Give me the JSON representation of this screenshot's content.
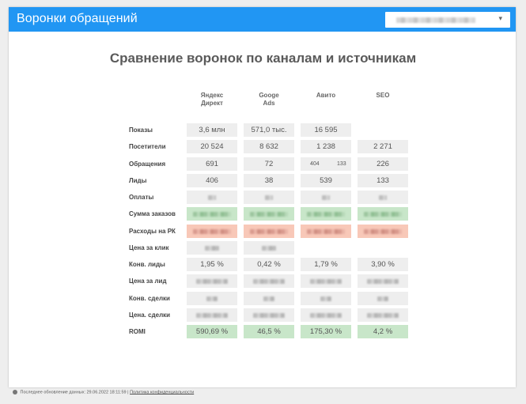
{
  "header": {
    "title": "Воронки обращений"
  },
  "report": {
    "title": "Сравнение воронок по каналам и источникам"
  },
  "columns": [
    "Яндекс\nДирект",
    "Googe\nAds",
    "Авито",
    "SEO"
  ],
  "rows": [
    {
      "label": "Показы",
      "cells": [
        {
          "v": "3,6 млн"
        },
        {
          "v": "571,0 тыс."
        },
        {
          "v": "16 595"
        },
        null
      ]
    },
    {
      "label": "Посетители",
      "cells": [
        {
          "v": "20 524"
        },
        {
          "v": "8 632"
        },
        {
          "v": "1 238"
        },
        {
          "v": "2 271"
        }
      ]
    },
    {
      "label": "Обращения",
      "cells": [
        {
          "v": "691"
        },
        {
          "v": "72"
        },
        {
          "split": [
            "404",
            "133"
          ]
        },
        {
          "v": "226"
        }
      ]
    },
    {
      "label": "Лиды",
      "cells": [
        {
          "v": "406"
        },
        {
          "v": "38"
        },
        {
          "v": "539"
        },
        {
          "v": "133"
        }
      ]
    },
    {
      "label": "Оплаты",
      "cells": [
        {
          "blur": 1
        },
        {
          "blur": 1
        },
        {
          "blur": 1
        },
        {
          "blur": 1
        }
      ]
    },
    {
      "label": "Сумма заказов",
      "tone": "green",
      "cells": [
        {
          "blur": 1
        },
        {
          "blur": 1
        },
        {
          "blur": 1
        },
        {
          "blur": 1
        }
      ]
    },
    {
      "label": "Расходы на РК",
      "tone": "red",
      "cells": [
        {
          "blur": 1
        },
        {
          "blur": 1
        },
        {
          "blur": 1
        },
        {
          "blur": 1
        }
      ]
    },
    {
      "label": "Цена за клик",
      "cells": [
        {
          "blur": 1
        },
        {
          "blur": 1
        },
        null,
        null
      ]
    },
    {
      "label": "Конв. лиды",
      "cells": [
        {
          "v": "1,95 %"
        },
        {
          "v": "0,42 %"
        },
        {
          "v": "1,79 %"
        },
        {
          "v": "3,90 %"
        }
      ]
    },
    {
      "label": "Цена за лид",
      "cells": [
        {
          "blur": 1
        },
        {
          "blur": 1
        },
        {
          "blur": 1
        },
        {
          "blur": 1
        }
      ]
    },
    {
      "label": "Конв. сделки",
      "cells": [
        {
          "blur": 1
        },
        {
          "blur": 1
        },
        {
          "blur": 1
        },
        {
          "blur": 1
        }
      ]
    },
    {
      "label": "Цена. сделки",
      "cells": [
        {
          "blur": 1
        },
        {
          "blur": 1
        },
        {
          "blur": 1
        },
        {
          "blur": 1
        }
      ]
    },
    {
      "label": "ROMI",
      "tone": "green",
      "cells": [
        {
          "v": "590,69 %"
        },
        {
          "v": "46,5 %"
        },
        {
          "v": "175,30 %"
        },
        {
          "v": "4,2 %"
        }
      ]
    }
  ],
  "footer": {
    "updated": "Последнее обновление данных: 29.06.2022 18:11:59",
    "separator": "|",
    "privacy": "Политика конфиденциальности"
  },
  "colors": {
    "header": "#2196f3",
    "green": "#c8e6c9",
    "red": "#f8c8b8",
    "neutral": "#eeeeee"
  }
}
